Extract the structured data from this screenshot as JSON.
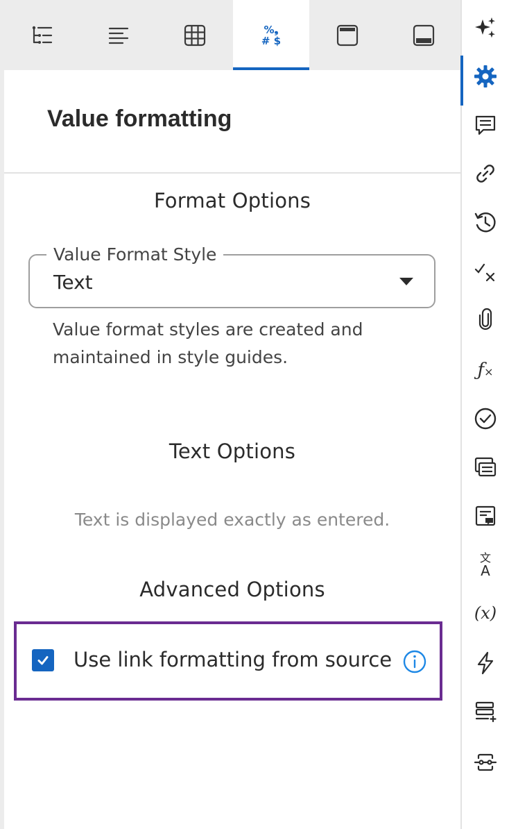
{
  "tabs": [
    {
      "id": "tree",
      "icon": "list-tree-icon"
    },
    {
      "id": "align",
      "icon": "align-left-icon"
    },
    {
      "id": "table",
      "icon": "table-grid-icon"
    },
    {
      "id": "value-format",
      "icon": "value-format-icon",
      "glyph_top": "%❟",
      "glyph_bottom": "# $",
      "active": true
    },
    {
      "id": "header",
      "icon": "window-header-icon"
    },
    {
      "id": "footer",
      "icon": "window-footer-icon"
    }
  ],
  "panel": {
    "title": "Value formatting",
    "format_options": {
      "heading": "Format Options",
      "select": {
        "legend": "Value Format Style",
        "value": "Text"
      },
      "helper": "Value format styles are created and maintained in style guides."
    },
    "text_options": {
      "heading": "Text Options",
      "description": "Text is displayed exactly as entered."
    },
    "advanced_options": {
      "heading": "Advanced Options",
      "checkbox_label": "Use link formatting from source",
      "checked": true
    }
  },
  "rail": {
    "items": [
      {
        "icon": "sparkle-icon"
      },
      {
        "icon": "gear-icon",
        "active": true
      },
      {
        "icon": "comment-icon"
      },
      {
        "icon": "link-icon"
      },
      {
        "icon": "history-icon"
      },
      {
        "icon": "check-cross-icon"
      },
      {
        "icon": "paperclip-icon"
      },
      {
        "icon": "function-icon",
        "text": "ƒ"
      },
      {
        "icon": "check-circle-icon"
      },
      {
        "icon": "messages-icon"
      },
      {
        "icon": "note-icon"
      },
      {
        "icon": "translate-icon",
        "text_top": "文",
        "text_bottom": "A"
      },
      {
        "icon": "variable-icon",
        "text": "(x)"
      },
      {
        "icon": "lightning-icon"
      },
      {
        "icon": "list-add-icon"
      },
      {
        "icon": "connector-icon"
      }
    ]
  },
  "colors": {
    "accent": "#1565c0",
    "highlight": "#6a2c91",
    "info": "#1e88e5"
  }
}
